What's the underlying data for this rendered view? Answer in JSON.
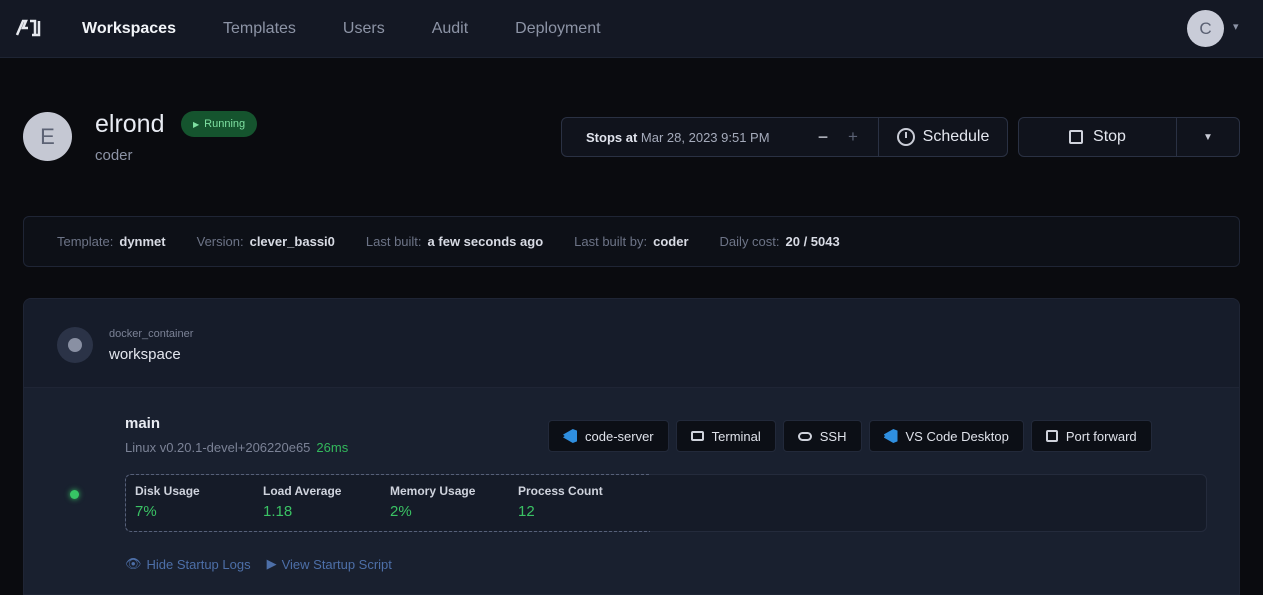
{
  "nav": {
    "items": [
      {
        "label": "Workspaces",
        "active": true
      },
      {
        "label": "Templates",
        "active": false
      },
      {
        "label": "Users",
        "active": false
      },
      {
        "label": "Audit",
        "active": false
      },
      {
        "label": "Deployment",
        "active": false
      }
    ],
    "user_initial": "C"
  },
  "workspace": {
    "initial": "E",
    "name": "elrond",
    "owner": "coder",
    "status": "Running"
  },
  "schedule": {
    "stops_label": "Stops at",
    "stops_time": "Mar 28, 2023 9:51 PM",
    "minus": "−",
    "plus": "+",
    "schedule_label": "Schedule"
  },
  "actions": {
    "stop_label": "Stop"
  },
  "stats": [
    {
      "label": "Template:",
      "value": "dynmet"
    },
    {
      "label": "Version:",
      "value": "clever_bassi0"
    },
    {
      "label": "Last built:",
      "value": "a few seconds ago"
    },
    {
      "label": "Last built by:",
      "value": "coder"
    },
    {
      "label": "Daily cost:",
      "value": "20 / 5043"
    }
  ],
  "resource": {
    "type": "docker_container",
    "name": "workspace"
  },
  "agent": {
    "name": "main",
    "os_version": "Linux  v0.20.1-devel+206220e65",
    "latency": "26ms",
    "apps": [
      {
        "label": "code-server",
        "icon": "vscode-icon"
      },
      {
        "label": "Terminal",
        "icon": "terminal-icon"
      },
      {
        "label": "SSH",
        "icon": "cloud-icon"
      },
      {
        "label": "VS Code Desktop",
        "icon": "vscode-icon"
      },
      {
        "label": "Port forward",
        "icon": "port-forward-icon"
      }
    ],
    "metrics": [
      {
        "label": "Disk Usage",
        "value": "7%"
      },
      {
        "label": "Load Average",
        "value": "1.18"
      },
      {
        "label": "Memory Usage",
        "value": "2%"
      },
      {
        "label": "Process Count",
        "value": "12"
      }
    ],
    "links": {
      "hide_logs": "Hide Startup Logs",
      "view_script": "View Startup Script"
    }
  },
  "colors": {
    "accent_green": "#37c465",
    "link_blue": "#4d6fa8",
    "badge_bg": "#15542e"
  }
}
